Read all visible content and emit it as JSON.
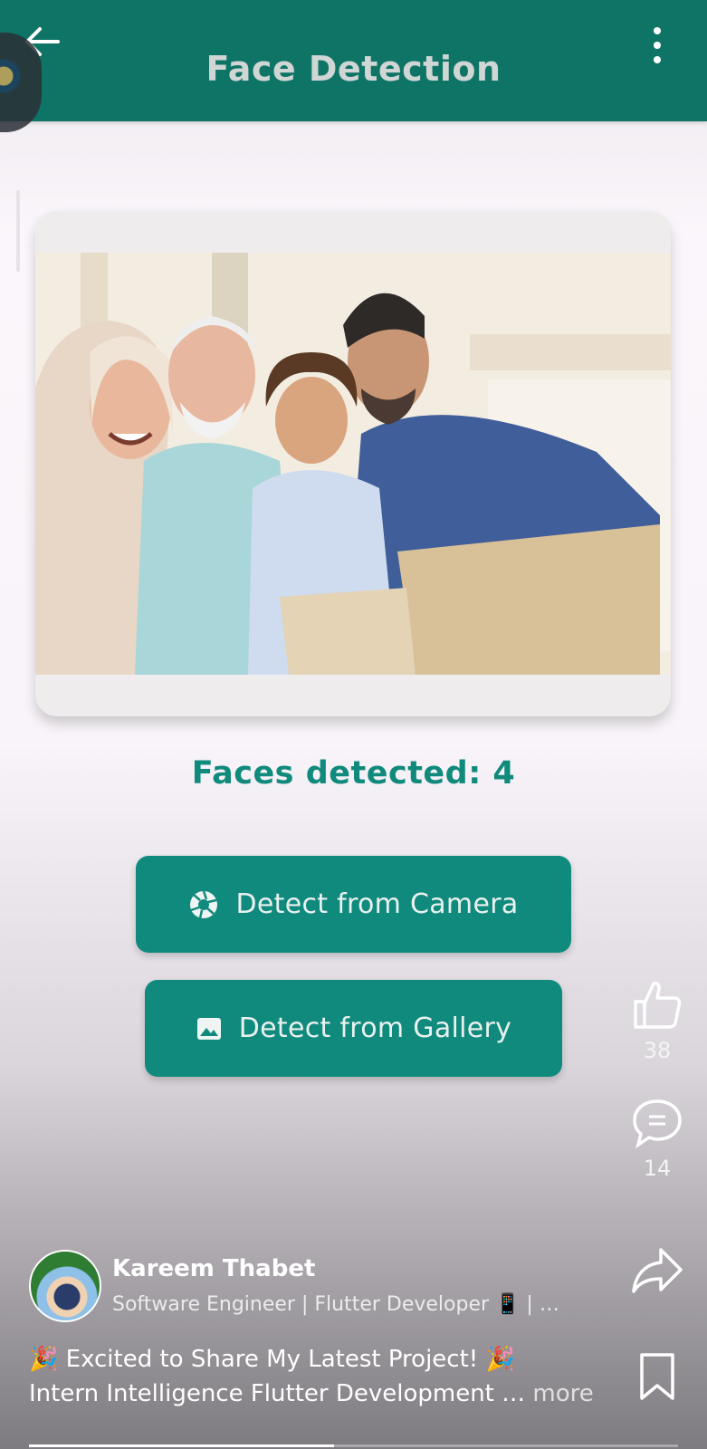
{
  "app_bar": {
    "title": "Face Detection",
    "back_icon": "arrow-left-icon",
    "menu_icon": "more-vertical-icon",
    "color": "#0e7466"
  },
  "result": {
    "faces_text": "Faces detected: 4"
  },
  "buttons": {
    "camera": {
      "label": "Detect from Camera",
      "icon": "camera-aperture-icon"
    },
    "gallery": {
      "label": "Detect from Gallery",
      "icon": "image-icon"
    },
    "color": "#108a7c"
  },
  "side_actions": {
    "like_count": "38",
    "comment_count": "14",
    "icons": [
      "thumbs-up-icon",
      "comment-icon",
      "share-icon",
      "bookmark-icon"
    ]
  },
  "author": {
    "name": "Kareem Thabet",
    "headline": "Software Engineer | Flutter Developer 📱 | …"
  },
  "caption": {
    "line1": "🎉 Excited to Share My Latest Project! 🎉",
    "line2": "Intern Intelligence Flutter Development",
    "ellipsis": "…",
    "more": "more"
  },
  "video_progress": 0.47
}
